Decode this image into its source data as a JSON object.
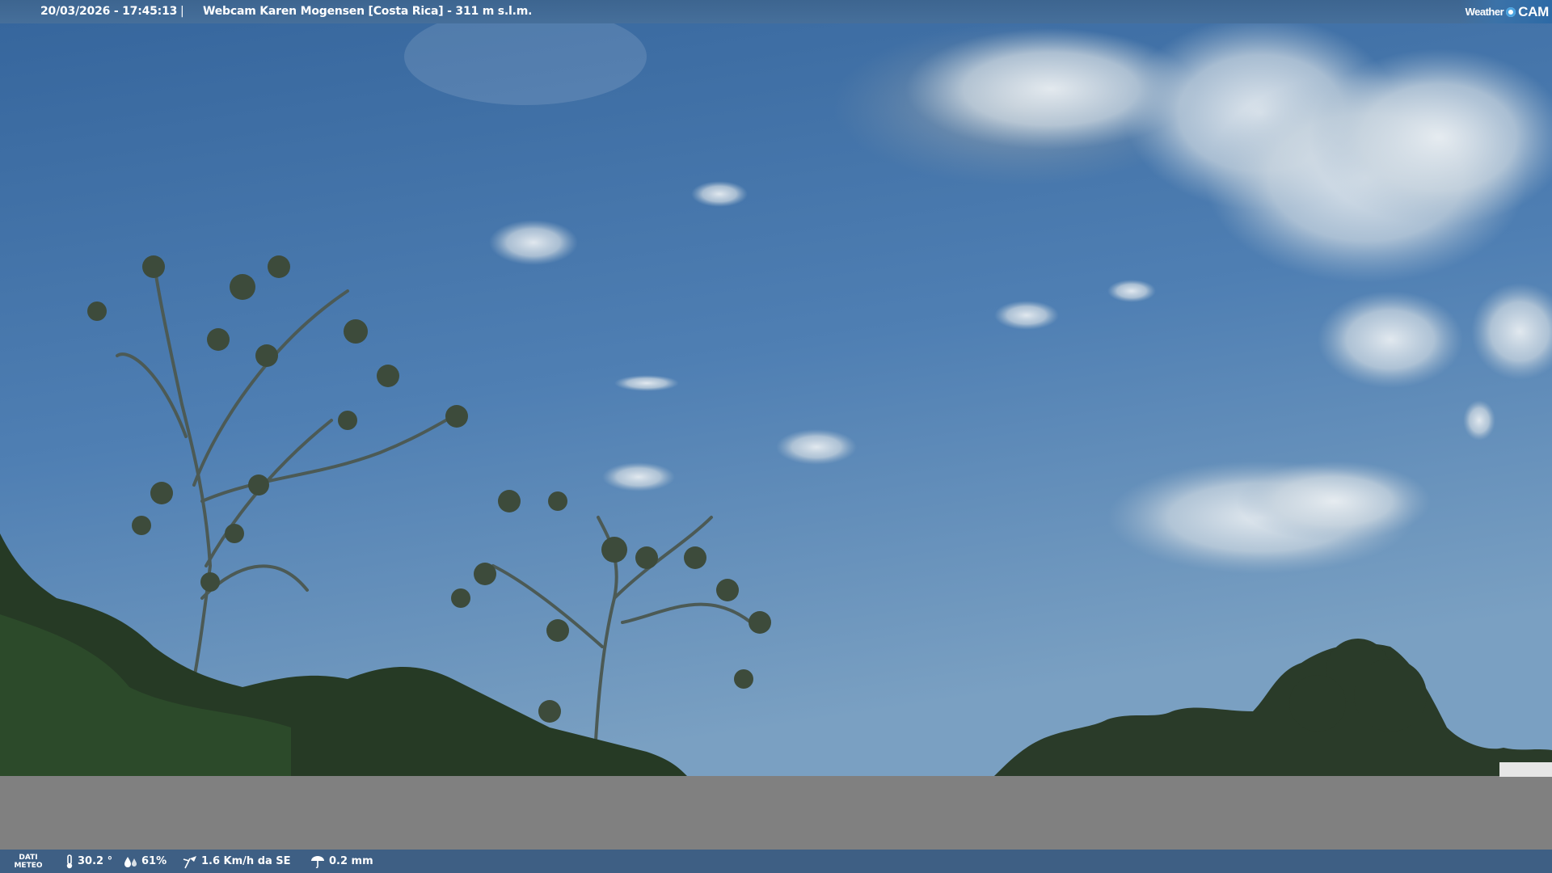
{
  "header": {
    "datetime": "20/03/2026 - 17:45:13",
    "separator": "|",
    "title": "Webcam Karen Mogensen [Costa Rica]  - 311 m s.l.m."
  },
  "logo": {
    "weather": "Weather",
    "cam": "CAM"
  },
  "footer": {
    "dati_line1": "DATI",
    "dati_line2": "METEO",
    "temperature": "30.2 °",
    "humidity": "61%",
    "wind": "1.6 Km/h da SE",
    "rain": "0.2 mm"
  },
  "colors": {
    "sky_top": "#3a6aa0",
    "sky_bottom": "#6f98bf",
    "bar": "#3e5f84",
    "ground": "#808080"
  },
  "icons": [
    "thermometer-icon",
    "humidity-icon",
    "wind-icon",
    "rain-icon"
  ]
}
